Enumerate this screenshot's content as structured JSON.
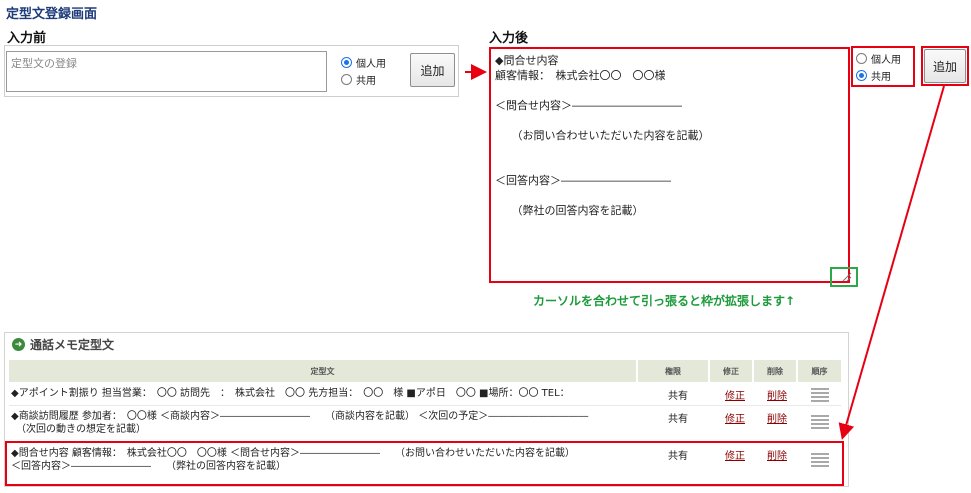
{
  "page": {
    "title": "定型文登録画面"
  },
  "before": {
    "label": "入力前",
    "textarea_placeholder": "定型文の登録",
    "radio_personal": "個人用",
    "radio_shared": "共用",
    "selected": "personal",
    "add_button": "追加"
  },
  "after": {
    "label": "入力後",
    "textarea_lines": [
      "◆問合せ内容",
      "顧客情報：　株式会社〇〇　〇〇様",
      "",
      "＜問合せ内容＞――――――――――",
      "",
      "　　（お問い合わせいただいた内容を記載）",
      "",
      "",
      "＜回答内容＞――――――――――",
      "",
      "　　（弊社の回答内容を記載）"
    ],
    "radio_personal": "個人用",
    "radio_shared": "共用",
    "selected": "shared",
    "add_button": "追加"
  },
  "hint": "カーソルを合わせて引っ張ると枠が拡張します↑",
  "memo": {
    "title": "通話メモ定型文",
    "columns": [
      "定型文",
      "権限",
      "修正",
      "削除",
      "順序"
    ],
    "rows": [
      {
        "line1": "◆アポイント割振り 担当営業：　〇〇 訪問先　：　株式会社　〇〇 先方担当：　〇〇　様 ■アポ日　〇〇 ■場所：〇〇 TEL：",
        "line2": "",
        "permission": "共有",
        "edit": "修正",
        "delete": "削除"
      },
      {
        "line1": "◆商談訪問履歴 参加者：　〇〇様 ＜商談内容＞―――――――――　　（商談内容を記載） ＜次回の予定＞――――――――――",
        "line2": "　（次回の動きの想定を記載）",
        "permission": "共有",
        "edit": "修正",
        "delete": "削除"
      },
      {
        "line1": "◆問合せ内容 顧客情報：　株式会社〇〇　〇〇様 ＜問合せ内容＞――――――――　　（お問い合わせいただいた内容を記載）",
        "line2": "＜回答内容＞――――――――　　（弊社の回答内容を記載）",
        "permission": "共有",
        "edit": "修正",
        "delete": "削除"
      }
    ]
  },
  "colors": {
    "highlight": "#e60012",
    "hint_green": "#1d9b3b",
    "title_blue": "#1d3b7a",
    "radio_blue": "#1a73e8"
  }
}
